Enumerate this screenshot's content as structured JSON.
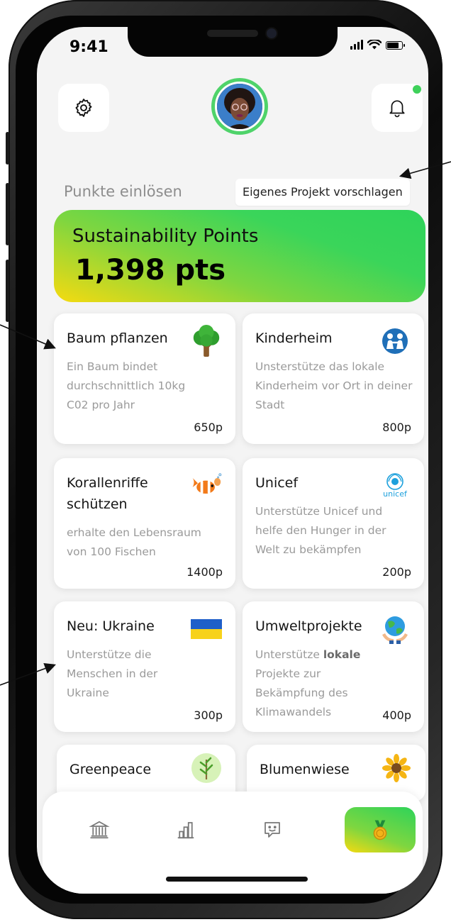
{
  "status_bar": {
    "time": "9:41",
    "battery_level": 0.85
  },
  "header": {
    "settings_icon": "gear-icon",
    "avatar_label": "user-avatar",
    "notification_icon": "bell-icon",
    "notification_dot_color": "#3ed15a"
  },
  "section": {
    "title": "Punkte einlösen",
    "propose_button": "Eigenes Projekt vorschlagen"
  },
  "points": {
    "label": "Sustainability Points",
    "value": "1,398 pts"
  },
  "cards": [
    {
      "title": "Baum pflanzen",
      "desc": "Ein Baum bindet durchschnittlich 10kg C02 pro Jahr",
      "points": "650p",
      "icon": "tree-icon"
    },
    {
      "title": "Kinderheim",
      "desc": "Unsterstütze das lokale Kinderheim vor Ort in deiner Stadt",
      "points": "800p",
      "icon": "children-icon"
    },
    {
      "title": "Korallenriffe schützen",
      "desc": "erhalte den Lebensraum von 100 Fischen",
      "points": "1400p",
      "icon": "clownfish-icon"
    },
    {
      "title": "Unicef",
      "desc": "Unterstütze Unicef und helfe den Hunger in der Welt zu bekämpfen",
      "points": "200p",
      "icon": "unicef-logo",
      "logo_text": "unicef"
    },
    {
      "title": "Neu: Ukraine",
      "desc": "Unterstütze die Menschen in der Ukraine",
      "points": "300p",
      "icon": "ukraine-flag-icon"
    },
    {
      "title": "Umweltprojekte",
      "desc_pre": "Unterstütze ",
      "desc_bold": "lokale",
      "desc_post": " Projekte zur Bekämpfung des Klimawandels",
      "points": "400p",
      "icon": "earth-hands-icon"
    },
    {
      "title": "Greenpeace",
      "icon": "sapling-icon"
    },
    {
      "title": "Blumenwiese",
      "icon": "sunflower-icon"
    }
  ],
  "tabbar": {
    "tabs": [
      "bank-icon",
      "chart-icon",
      "chat-icon",
      "medal-icon"
    ],
    "active": "medal-icon"
  },
  "colors": {
    "accent_green": "#2ed35a",
    "accent_yellow": "#f6da10",
    "background": "#f4f4f4"
  }
}
